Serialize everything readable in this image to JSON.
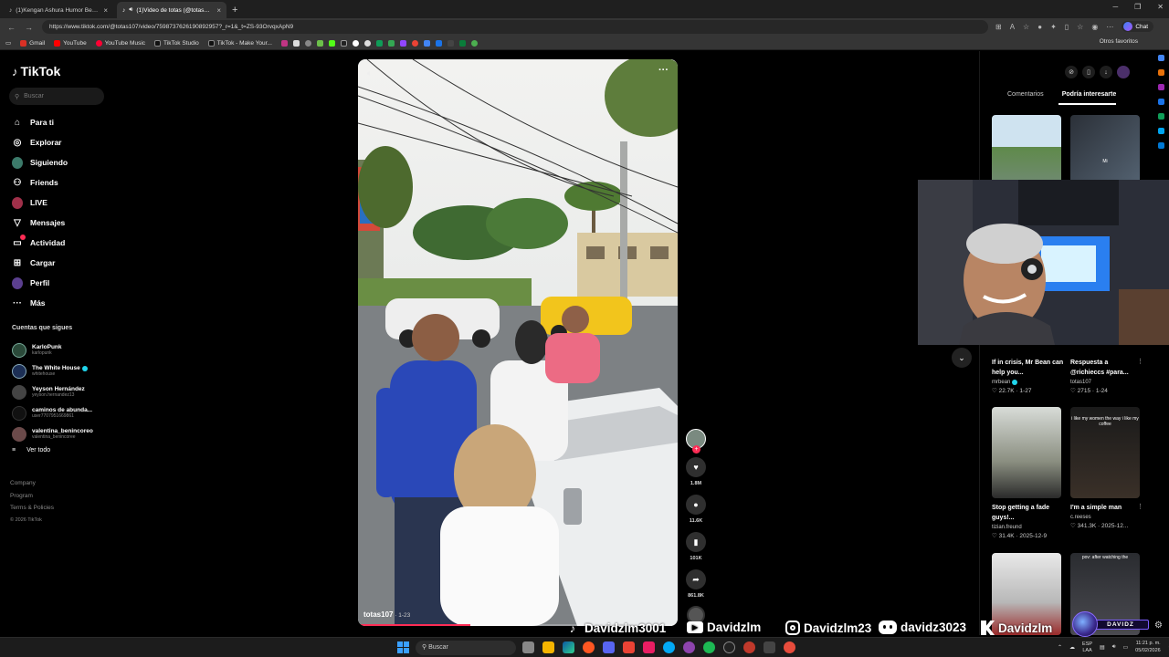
{
  "browser": {
    "tabs": [
      {
        "title": "(1)Kengan Ashura Humor Best M",
        "active": false
      },
      {
        "title": "(1)Video de totas (@totas107)",
        "active": true
      }
    ],
    "new_tab": "+",
    "url": "https://www.tiktok.com/@totas107/video/7598737626190892957?_r=1&_t=ZS-93OrvqxApN9",
    "chat_label": "Chat",
    "bookmarks": [
      "Gmail",
      "YouTube",
      "YouTube Music",
      "TikTok Studio",
      "TikTok - Make Your..."
    ],
    "other_bookmarks": "Otros favoritos"
  },
  "sidebar": {
    "logo": "TikTok",
    "search_placeholder": "Buscar",
    "nav": [
      {
        "label": "Para ti",
        "icon": "home-icon"
      },
      {
        "label": "Explorar",
        "icon": "compass-icon"
      },
      {
        "label": "Siguiendo",
        "icon": "following-avatar"
      },
      {
        "label": "Friends",
        "icon": "friends-icon"
      },
      {
        "label": "LIVE",
        "icon": "live-icon"
      },
      {
        "label": "Mensajes",
        "icon": "messages-icon"
      },
      {
        "label": "Actividad",
        "icon": "activity-icon"
      },
      {
        "label": "Cargar",
        "icon": "upload-icon"
      },
      {
        "label": "Perfil",
        "icon": "profile-avatar"
      },
      {
        "label": "Más",
        "icon": "more-icon"
      }
    ],
    "following_title": "Cuentas que sigues",
    "following": [
      {
        "name": "KarloPunk",
        "user": "karlopunk",
        "verified": false
      },
      {
        "name": "The White House",
        "user": "whitehouse",
        "verified": true
      },
      {
        "name": "Yeyson Hernández",
        "user": "yeyson.hernandez13",
        "verified": false
      },
      {
        "name": "caminos de abunda...",
        "user": "user7707951669861",
        "verified": false
      },
      {
        "name": "valentina_benincoreo",
        "user": "valentina_benincoree",
        "verified": false
      }
    ],
    "see_all": "Ver todo",
    "footer": [
      "Company",
      "Program",
      "Terms & Policies"
    ],
    "copyright": "© 2026 TikTok"
  },
  "video": {
    "author": "totas107",
    "date": " · 1-23",
    "progress": 0.35
  },
  "actions": {
    "likes": "1.8M",
    "comments": "11.6K",
    "saves": "101K",
    "shares": "861.8K"
  },
  "right_panel": {
    "tabs": [
      "Comentarios",
      "Podría interesarte"
    ],
    "active_tab": "Podría interesarte",
    "thumb_captions": [
      "",
      "Mi"
    ],
    "cards": [
      {
        "title": "If in crisis, Mr Bean can help you...",
        "user": "mrbean",
        "verified": true,
        "likes": "22.7K",
        "date": "1-27"
      },
      {
        "title": "Respuesta a @richieccs #para...",
        "user": "totas107",
        "verified": false,
        "likes": "2715",
        "date": "1-24"
      },
      {
        "title": "Stop getting a fade guys!...",
        "user": "tizian.freund",
        "verified": false,
        "likes": "31.4K",
        "date": "2025-12-9"
      },
      {
        "title": "I'm a simple man",
        "user": "c.reeses",
        "verified": false,
        "likes": "341.3K",
        "date": "2025-12..."
      }
    ],
    "simple_man_caption": "i like my women the way i like my coffee",
    "last_caption": "pov: after watching the"
  },
  "stream_overlay": {
    "tiktok": "Davidzlm3001",
    "youtube": "Davidzlm",
    "instagram": "Davidzlm23",
    "discord": "davidz3023",
    "kick": "Davidzlm",
    "badge": "DAVIDZ"
  },
  "taskbar": {
    "search": "Buscar",
    "lang_line1": "ESP",
    "lang_line2": "LAA",
    "time": "11:21 p. m.",
    "date": "05/02/2026"
  }
}
